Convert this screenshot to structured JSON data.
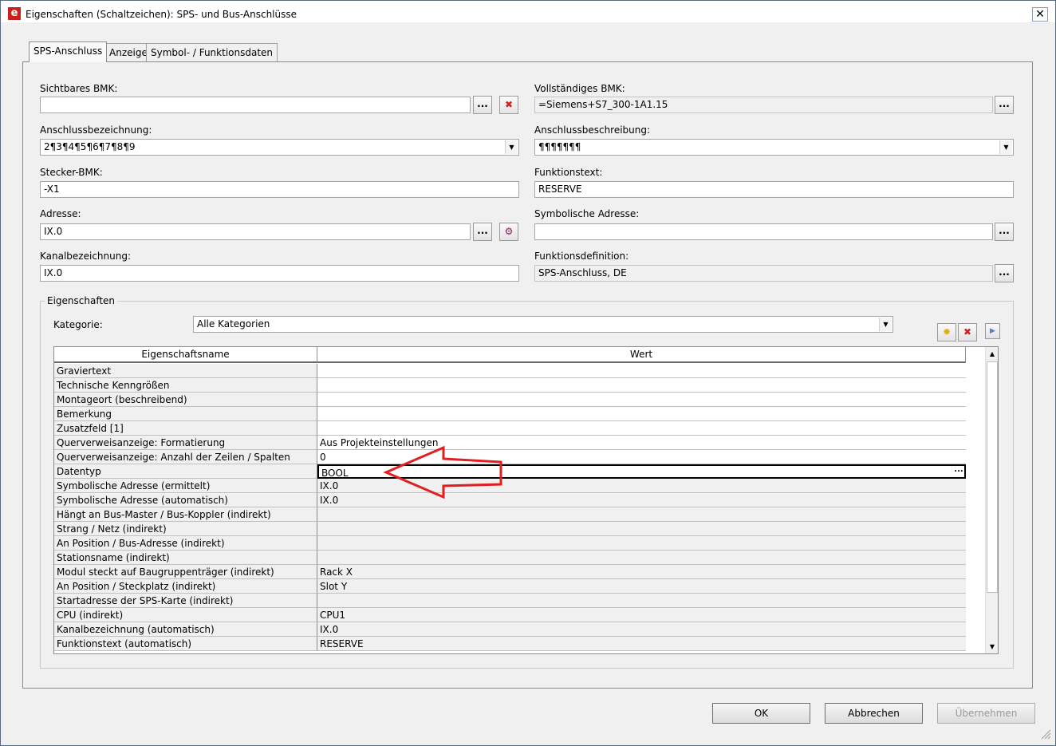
{
  "window": {
    "title": "Eigenschaften (Schaltzeichen): SPS- und Bus-Anschlüsse",
    "close": "✕",
    "app_icon": "e"
  },
  "tabs": [
    {
      "label": "SPS-Anschluss",
      "active": true
    },
    {
      "label": "Anzeige",
      "active": false
    },
    {
      "label": "Symbol- / Funktionsdaten",
      "active": false
    }
  ],
  "form": {
    "sichtbares_bmk": {
      "label": "Sichtbares BMK:",
      "value": ""
    },
    "vollstaendiges_bmk": {
      "label": "Vollständiges BMK:",
      "value": "=Siemens+S7_300-1A1.15"
    },
    "anschlussbezeichnung": {
      "label": "Anschlussbezeichnung:",
      "value": "2¶3¶4¶5¶6¶7¶8¶9"
    },
    "anschlussbeschreibung": {
      "label": "Anschlussbeschreibung:",
      "value": "¶¶¶¶¶¶¶"
    },
    "stecker_bmk": {
      "label": "Stecker-BMK:",
      "value": "-X1"
    },
    "funktionstext": {
      "label": "Funktionstext:",
      "value": "RESERVE"
    },
    "adresse": {
      "label": "Adresse:",
      "value": "IX.0"
    },
    "symbolische_adresse": {
      "label": "Symbolische Adresse:",
      "value": ""
    },
    "kanalbezeichnung": {
      "label": "Kanalbezeichnung:",
      "value": "IX.0"
    },
    "funktionsdefinition": {
      "label": "Funktionsdefinition:",
      "value": "SPS-Anschluss, DE"
    },
    "dots": "...",
    "delete_glyph": "✖",
    "plc_glyph": "⚙"
  },
  "properties": {
    "group_title": "Eigenschaften",
    "kategorie_label": "Kategorie:",
    "kategorie_value": "Alle Kategorien",
    "toolbar": {
      "new_glyph": "✹",
      "delete_glyph": "✖",
      "expand_glyph": "▶"
    },
    "columns": [
      "Eigenschaftsname",
      "Wert"
    ],
    "rows": [
      {
        "name": "Graviertext",
        "value": ""
      },
      {
        "name": "Technische Kenngrößen",
        "value": ""
      },
      {
        "name": "Montageort (beschreibend)",
        "value": ""
      },
      {
        "name": "Bemerkung",
        "value": ""
      },
      {
        "name": "Zusatzfeld [1]",
        "value": ""
      },
      {
        "name": "Querverweisanzeige: Formatierung",
        "value": "Aus Projekteinstellungen"
      },
      {
        "name": "Querverweisanzeige: Anzahl der Zeilen / Spalten",
        "value": "0"
      },
      {
        "name": "Datentyp",
        "value": "BOOL"
      },
      {
        "name": "Symbolische Adresse (ermittelt)",
        "value": "IX.0"
      },
      {
        "name": "Symbolische Adresse (automatisch)",
        "value": "IX.0"
      },
      {
        "name": "Hängt an Bus-Master / Bus-Koppler (indirekt)",
        "value": ""
      },
      {
        "name": "Strang / Netz (indirekt)",
        "value": ""
      },
      {
        "name": "An Position / Bus-Adresse (indirekt)",
        "value": ""
      },
      {
        "name": "Stationsname (indirekt)",
        "value": ""
      },
      {
        "name": "Modul steckt auf Baugruppenträger (indirekt)",
        "value": "Rack X"
      },
      {
        "name": "An Position / Steckplatz (indirekt)",
        "value": "Slot Y"
      },
      {
        "name": "Startadresse der SPS-Karte (indirekt)",
        "value": ""
      },
      {
        "name": "CPU (indirekt)",
        "value": "CPU1"
      },
      {
        "name": "Kanalbezeichnung (automatisch)",
        "value": "IX.0"
      },
      {
        "name": "Funktionstext (automatisch)",
        "value": "RESERVE"
      }
    ],
    "edit_dots": "..."
  },
  "buttons": {
    "ok": "OK",
    "cancel": "Abbrechen",
    "apply": "Übernehmen"
  },
  "colors": {
    "arrow": "#e02020",
    "app_icon": "#c8201c"
  }
}
